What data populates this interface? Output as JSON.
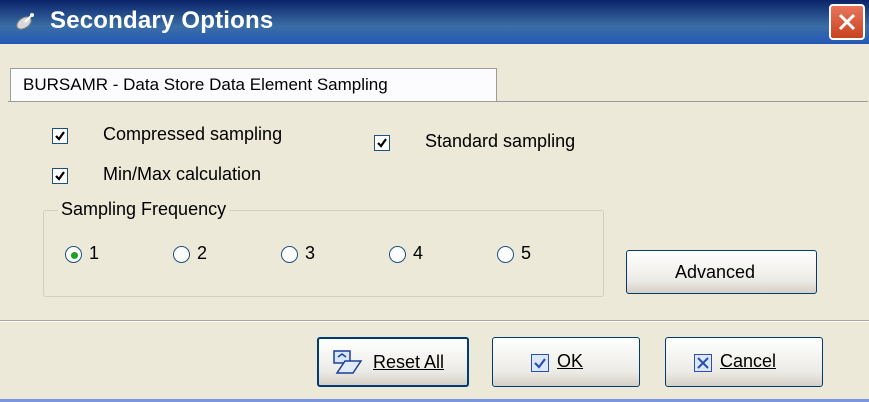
{
  "window": {
    "title": "Secondary Options",
    "title_icon": "satellite-icon",
    "close_icon": "close-icon"
  },
  "tab": {
    "label": "BURSAMR - Data Store Data Element Sampling"
  },
  "options": {
    "compressed": {
      "label": "Compressed sampling",
      "checked": true
    },
    "standard": {
      "label": "Standard sampling",
      "checked": true
    },
    "minmax": {
      "label": "Min/Max calculation",
      "checked": true
    }
  },
  "frequency": {
    "label": "Sampling Frequency",
    "options": [
      "1",
      "2",
      "3",
      "4",
      "5"
    ],
    "selected": "1"
  },
  "buttons": {
    "advanced": "Advanced",
    "reset_all": "Reset All",
    "ok": "OK",
    "cancel": "Cancel"
  },
  "colors": {
    "titlebar": "#0A246A",
    "face": "#ECE9D8",
    "check_mark": "#000000",
    "radio_dot": "#21A121",
    "close_button": "#C8421E"
  }
}
